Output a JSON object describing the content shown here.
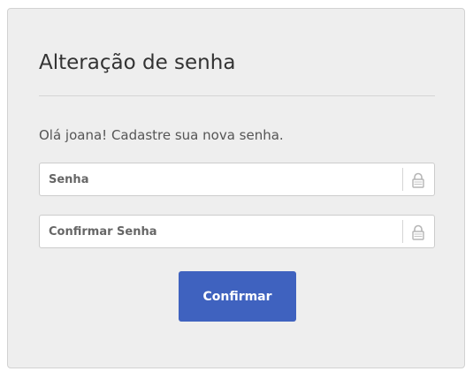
{
  "form": {
    "title": "Alteração de senha",
    "greeting": "Olá joana! Cadastre sua nova senha.",
    "password_field": {
      "placeholder": "Senha",
      "value": "",
      "icon": "lock-icon"
    },
    "confirm_field": {
      "placeholder": "Confirmar Senha",
      "value": "",
      "icon": "lock-icon"
    },
    "submit_label": "Confirmar"
  },
  "colors": {
    "card_background": "#eeeeee",
    "button_background": "#3f62bf",
    "button_text": "#ffffff",
    "title_text": "#333333"
  }
}
